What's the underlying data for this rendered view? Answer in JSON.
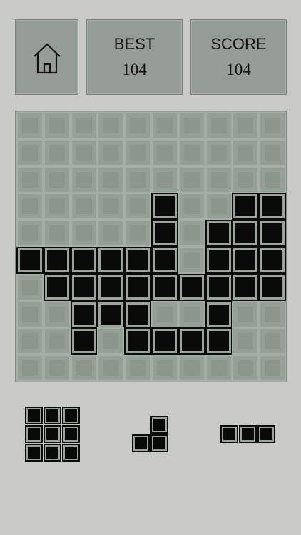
{
  "header": {
    "home_icon": "home-icon",
    "best_label": "BEST",
    "best_value": "104",
    "score_label": "SCORE",
    "score_value": "104"
  },
  "colors": {
    "background": "#c9cac6",
    "panel": "#959c96",
    "board": "#94a096",
    "block": "#0b0b0b"
  },
  "board": {
    "columns": 10,
    "rows": 10,
    "grid": [
      "0000000000",
      "0000000000",
      "0000000000",
      "0000010011",
      "0000010111",
      "1111110111",
      "0111111111",
      "0011100100",
      "0010111100",
      "0000000000"
    ]
  },
  "pieces": [
    {
      "name": "square-3x3",
      "shape": [
        "111",
        "111",
        "111"
      ]
    },
    {
      "name": "corner-l",
      "shape": [
        "01",
        "11"
      ]
    },
    {
      "name": "line-3",
      "shape": [
        "111"
      ]
    }
  ]
}
